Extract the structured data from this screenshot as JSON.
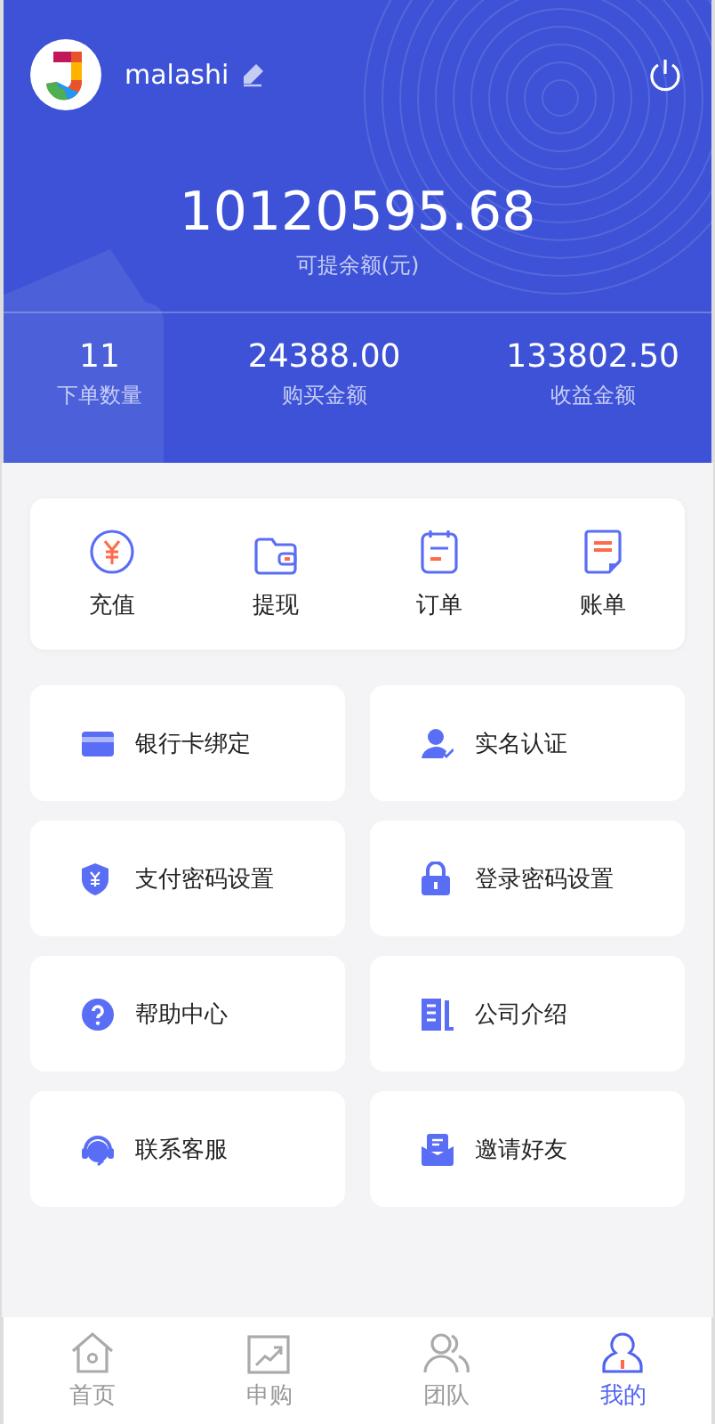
{
  "user": {
    "name": "malashi"
  },
  "balance": {
    "amount": "10120595.68",
    "label": "可提余额(元)"
  },
  "stats": [
    {
      "value": "11",
      "label": "下单数量"
    },
    {
      "value": "24388.00",
      "label": "购买金额"
    },
    {
      "value": "133802.50",
      "label": "收益金额"
    }
  ],
  "quick_actions": [
    {
      "label": "充值"
    },
    {
      "label": "提现"
    },
    {
      "label": "订单"
    },
    {
      "label": "账单"
    }
  ],
  "menu": [
    {
      "label": "银行卡绑定"
    },
    {
      "label": "实名认证"
    },
    {
      "label": "支付密码设置"
    },
    {
      "label": "登录密码设置"
    },
    {
      "label": "帮助中心"
    },
    {
      "label": "公司介绍"
    },
    {
      "label": "联系客服"
    },
    {
      "label": "邀请好友"
    }
  ],
  "tab_bar": [
    {
      "label": "首页",
      "selected": false
    },
    {
      "label": "申购",
      "selected": false
    },
    {
      "label": "团队",
      "selected": false
    },
    {
      "label": "我的",
      "selected": true
    }
  ]
}
